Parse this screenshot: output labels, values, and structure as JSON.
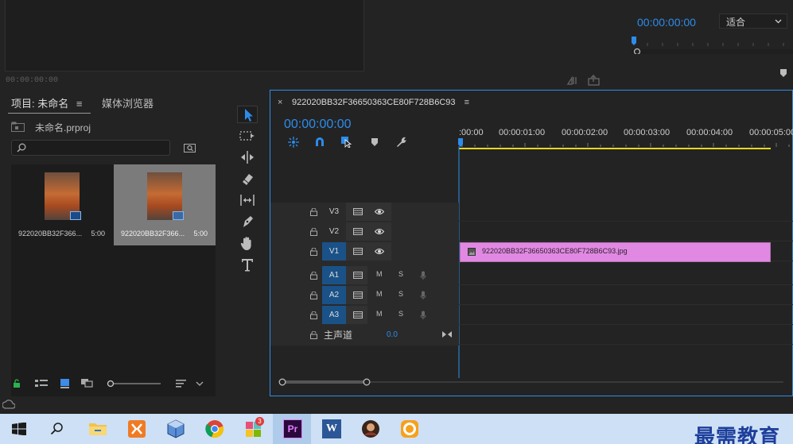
{
  "source_monitor": {
    "timecode": "00:00:00:00"
  },
  "program_monitor": {
    "timecode": "00:00:00:00",
    "fit_value": "适合"
  },
  "project_panel": {
    "tab_label": "项目: 未命名",
    "media_tab_label": "媒体浏览器",
    "project_file": "未命名.prproj",
    "search_placeholder": "",
    "items": [
      {
        "name": "922020BB32F366...",
        "duration": "5:00",
        "selected": false
      },
      {
        "name": "922020BB32F366...",
        "duration": "5:00",
        "selected": true
      }
    ]
  },
  "tools": [
    "selection-tool",
    "track-select-tool",
    "ripple-edit-tool",
    "razor-tool",
    "slip-tool",
    "pen-tool",
    "hand-tool",
    "type-tool"
  ],
  "timeline": {
    "sequence_name": "922020BB32F36650363CE80F728B6C93",
    "close_symbol": "×",
    "timecode": "00:00:00:00",
    "ruler_labels": [
      ":00:00",
      "00:00:01:00",
      "00:00:02:00",
      "00:00:03:00",
      "00:00:04:00",
      "00:00:05:00"
    ],
    "video_tracks": [
      {
        "name": "V3",
        "targeted": false
      },
      {
        "name": "V2",
        "targeted": false
      },
      {
        "name": "V1",
        "targeted": true
      }
    ],
    "audio_tracks": [
      {
        "name": "A1",
        "mute": "M",
        "solo": "S"
      },
      {
        "name": "A2",
        "mute": "M",
        "solo": "S"
      },
      {
        "name": "A3",
        "mute": "M",
        "solo": "S"
      }
    ],
    "master": {
      "label": "主声道",
      "value": "0.0"
    },
    "clip": {
      "name": "922020BB32F36650363CE80F728B6C93.jpg",
      "color": "#e189e2"
    }
  },
  "taskbar": {
    "apps": [
      "windows-start",
      "search",
      "file-explorer",
      "xampp",
      "virtualbox",
      "chrome",
      "app-badge-3",
      "premiere-pro",
      "word",
      "avatar-app",
      "orange-app"
    ],
    "premiere_label": "Pr",
    "word_label": "W",
    "badge_count": "3",
    "watermark": "最需教育"
  },
  "colors": {
    "accent": "#2d8ceb",
    "clip": "#e189e2",
    "background": "#232323",
    "taskbar": "#cde0f5"
  }
}
